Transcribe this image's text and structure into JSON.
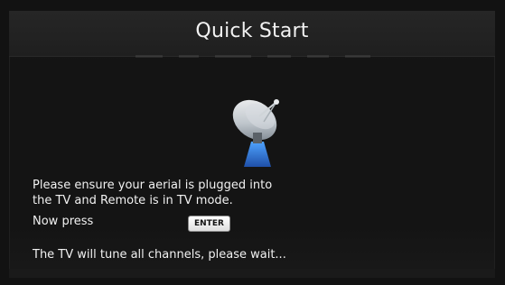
{
  "header": {
    "title": "Quick Start"
  },
  "icons": {
    "dish": "satellite-dish-icon"
  },
  "message": {
    "line1": "Please ensure your aerial is plugged into",
    "line2": "the TV and Remote is in TV mode.",
    "press_text": "Now press",
    "enter_label": "ENTER",
    "wait_text": "The TV will tune all channels, please wait..."
  },
  "colors": {
    "background": "#141414",
    "text": "#f1f1f1",
    "dish_base": "#2f7fd0"
  }
}
